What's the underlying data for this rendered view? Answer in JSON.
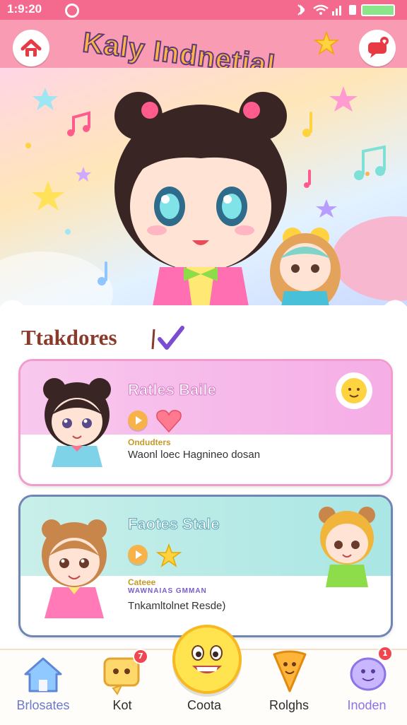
{
  "status_bar": {
    "time": "1:9:20"
  },
  "header": {
    "app_title": "Kaly Indnetial"
  },
  "section": {
    "heading": "Ttakdores"
  },
  "cards": [
    {
      "title": "Ratles Baile",
      "label": "Ondudters",
      "description": "Waonl loec Hagnineo dosan"
    },
    {
      "title": "Faotes Stale",
      "label": "Cateee",
      "tag": "WAWNAIAS GMMAN",
      "description": "Tnkamltolnet Resde)"
    }
  ],
  "bottom_nav": {
    "items": [
      {
        "label": "Brlosates"
      },
      {
        "label": "Kot",
        "badge": "7"
      },
      {
        "label": "Coota"
      },
      {
        "label": "Rolghs"
      },
      {
        "label": "Inoden",
        "badge": "1"
      }
    ]
  },
  "colors": {
    "primary": "#f46a8e",
    "header": "#f89bb3",
    "card_pink": "#f09ccd",
    "card_blue": "#6f86b3",
    "accent_yellow": "#ffe34f"
  }
}
